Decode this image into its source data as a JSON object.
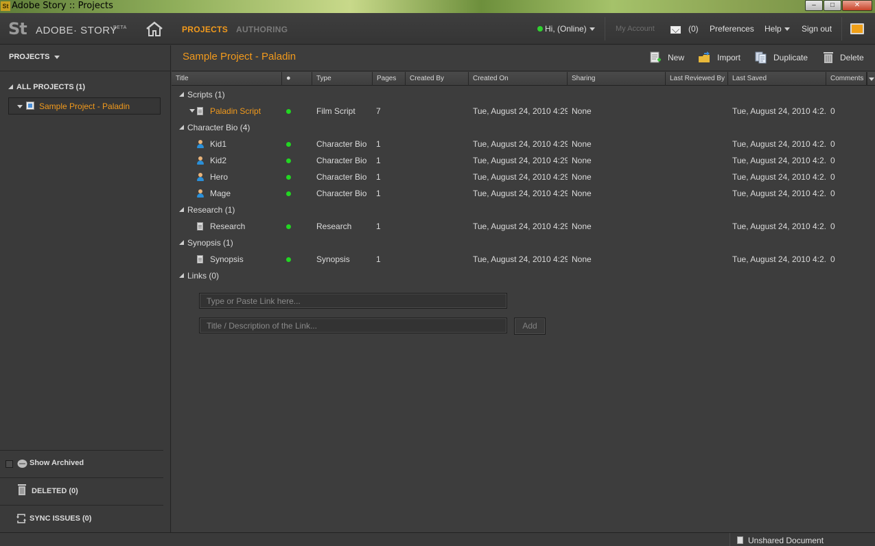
{
  "window": {
    "title": "Adobe Story :: Projects",
    "app_icon_text": "St",
    "buttons": {
      "minimize": "–",
      "restore": "□",
      "close": "✕"
    }
  },
  "header": {
    "logo_short": "St",
    "logo_name": "ADOBE· STORY",
    "logo_badge": "BETA",
    "tabs": [
      {
        "label": "PROJECTS",
        "active": true
      },
      {
        "label": "AUTHORING",
        "active": false
      }
    ],
    "online_label": "Hi,  (Online)",
    "my_account": "My Account",
    "mail_count": "(0)",
    "preferences": "Preferences",
    "help": "Help",
    "sign_out": "Sign out"
  },
  "sidebar": {
    "heading": "PROJECTS",
    "all_projects": "ALL PROJECTS (1)",
    "project": "Sample Project - Paladin",
    "show_archived": "Show Archived",
    "deleted": "DELETED (0)",
    "sync_issues": "SYNC ISSUES (0)"
  },
  "main": {
    "title": "Sample Project - Paladin",
    "toolbar": {
      "new": "New",
      "import": "Import",
      "duplicate": "Duplicate",
      "delete": "Delete"
    },
    "columns": {
      "title": "Title",
      "status": "●",
      "type": "Type",
      "pages": "Pages",
      "created_by": "Created By",
      "created_on": "Created On",
      "sharing": "Sharing",
      "last_reviewed_by": "Last Reviewed By",
      "last_saved": "Last Saved",
      "comments": "Comments"
    },
    "groups": [
      {
        "label": "Scripts (1)"
      },
      {
        "label": "Character Bio (4)"
      },
      {
        "label": "Research (1)"
      },
      {
        "label": "Synopsis (1)"
      },
      {
        "label": "Links (0)"
      }
    ],
    "items": [
      {
        "title": "Paladin Script",
        "type": "Film Script",
        "pages": "7",
        "created_on": "Tue, August 24, 2010 4:29...",
        "sharing": "None",
        "last_saved": "Tue, August 24, 2010 4:2...",
        "comments": "0"
      },
      {
        "title": "Kid1",
        "type": "Character Bio",
        "pages": "1",
        "created_on": "Tue, August 24, 2010 4:29...",
        "sharing": "None",
        "last_saved": "Tue, August 24, 2010 4:2...",
        "comments": "0"
      },
      {
        "title": "Kid2",
        "type": "Character Bio",
        "pages": "1",
        "created_on": "Tue, August 24, 2010 4:29...",
        "sharing": "None",
        "last_saved": "Tue, August 24, 2010 4:2...",
        "comments": "0"
      },
      {
        "title": "Hero",
        "type": "Character Bio",
        "pages": "1",
        "created_on": "Tue, August 24, 2010 4:29...",
        "sharing": "None",
        "last_saved": "Tue, August 24, 2010 4:2...",
        "comments": "0"
      },
      {
        "title": "Mage",
        "type": "Character Bio",
        "pages": "1",
        "created_on": "Tue, August 24, 2010 4:29...",
        "sharing": "None",
        "last_saved": "Tue, August 24, 2010 4:2...",
        "comments": "0"
      },
      {
        "title": "Research",
        "type": "Research",
        "pages": "1",
        "created_on": "Tue, August 24, 2010 4:29...",
        "sharing": "None",
        "last_saved": "Tue, August 24, 2010 4:2...",
        "comments": "0"
      },
      {
        "title": "Synopsis",
        "type": "Synopsis",
        "pages": "1",
        "created_on": "Tue, August 24, 2010 4:29...",
        "sharing": "None",
        "last_saved": "Tue, August 24, 2010 4:2...",
        "comments": "0"
      }
    ],
    "links": {
      "link_placeholder": "Type or Paste Link here...",
      "desc_placeholder": "Title / Description of the Link...",
      "add_label": "Add"
    }
  },
  "statusbar": {
    "document_state": "Unshared Document"
  },
  "colors": {
    "accent": "#f29a1c",
    "online": "#2fd12f",
    "background": "#3a3a3a"
  }
}
